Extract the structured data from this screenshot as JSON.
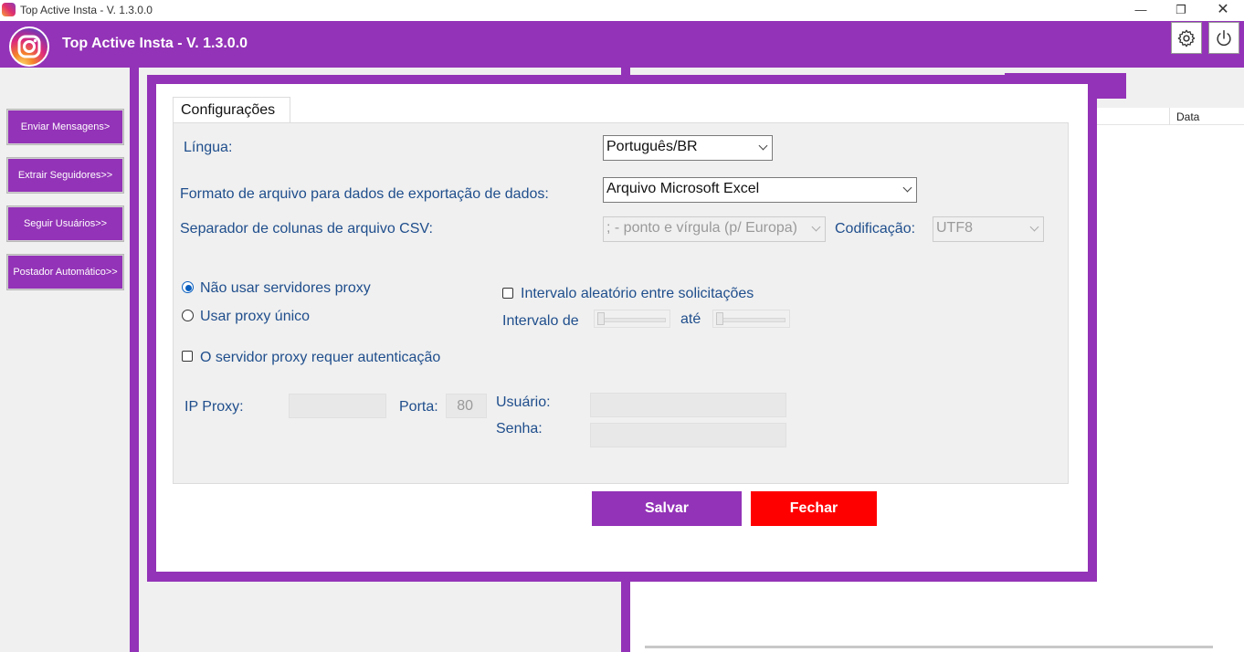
{
  "window": {
    "title": "Top Active Insta - V. 1.3.0.0"
  },
  "header": {
    "title": "Top Active Insta - V. 1.3.0.0"
  },
  "sidebar": {
    "items": [
      {
        "label": "Enviar Mensagens>"
      },
      {
        "label": "Extrair Seguidores>>"
      },
      {
        "label": "Seguir Usuários>>"
      },
      {
        "label": "Postador Automático>>"
      }
    ]
  },
  "background": {
    "column_header": "Data"
  },
  "settings": {
    "tab": "Configurações",
    "language": {
      "label": "Língua:",
      "value": "Português/BR"
    },
    "export_format": {
      "label": "Formato de arquivo para dados de exportação de dados:",
      "value": "Arquivo Microsoft Excel"
    },
    "csv_separator": {
      "label": "Separador de colunas de arquivo CSV:",
      "value": "; - ponto e vírgula (p/ Europa)"
    },
    "encoding": {
      "label": "Codificação:",
      "value": "UTF8"
    },
    "proxy": {
      "no_proxy": "Não usar servidores proxy",
      "single_proxy": "Usar proxy único",
      "auth_required": "O servidor proxy requer autenticação",
      "ip_label": "IP Proxy:",
      "port_label": "Porta:",
      "port_value": "80",
      "user_label": "Usuário:",
      "password_label": "Senha:"
    },
    "interval": {
      "random_label": "Intervalo aleatório entre solicitações",
      "from_label": "Intervalo de",
      "to_label": "até"
    },
    "buttons": {
      "save": "Salvar",
      "close": "Fechar"
    }
  },
  "colors": {
    "brand": "#9333b7",
    "danger": "#ff0000",
    "label": "#1f4e8c"
  }
}
